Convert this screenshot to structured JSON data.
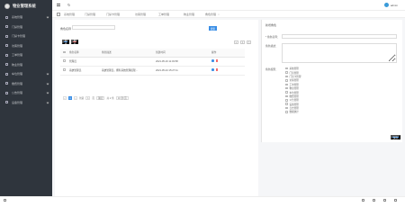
{
  "app": {
    "logo_text": "物业管理系统"
  },
  "header": {
    "user_name": "admin",
    "refresh_symbol": "↻"
  },
  "sidebar": {
    "items": [
      {
        "label": "系统管理",
        "icon": "settings-icon"
      },
      {
        "label": "门禁管理",
        "icon": "door-icon"
      },
      {
        "label": "门禁卡管理",
        "icon": "card-icon"
      },
      {
        "label": "访客管理",
        "icon": "visitor-icon"
      },
      {
        "label": "工单管理",
        "icon": "ticket-icon"
      },
      {
        "label": "物业管理",
        "icon": "building-icon"
      },
      {
        "label": "车位管理",
        "icon": "parking-icon"
      },
      {
        "label": "缴费管理",
        "icon": "payment-icon"
      },
      {
        "label": "公告管理",
        "icon": "notice-icon"
      },
      {
        "label": "设备管理",
        "icon": "device-icon"
      }
    ]
  },
  "tabs": [
    {
      "label": "系统管理"
    },
    {
      "label": "门禁管理"
    },
    {
      "label": "门禁卡管理"
    },
    {
      "label": "访客管理"
    },
    {
      "label": "工单管理"
    },
    {
      "label": "物业管理"
    },
    {
      "label": "角色管理"
    }
  ],
  "search": {
    "label": "角色名称",
    "placeholder": "",
    "button": "搜索"
  },
  "toolbar": {
    "add": "新增",
    "delete": "删除"
  },
  "table": {
    "columns": [
      "角色名称",
      "角色描述",
      "创建时间",
      "操作"
    ],
    "rows": [
      {
        "name": "管理员",
        "desc": "",
        "created": "2021-05-16 11:03:58"
      },
      {
        "name": "系统管理员",
        "desc": "系统管理员，拥有系统管理权限…",
        "created": "2021-05-24 15:27:11"
      }
    ]
  },
  "pager": {
    "prev": "‹",
    "page": "1",
    "next": "›",
    "goto_label": "到第",
    "page_input": "1",
    "page_suffix": "页",
    "confirm": "确定",
    "total": "共 2 条",
    "size": "10 条/页"
  },
  "form": {
    "title": "新增角色",
    "name_label": "* 角色名称：",
    "desc_label": "角色描述：",
    "perm_label": "角色权限：",
    "permissions": [
      "系统管理",
      "门禁管理",
      "门禁卡管理",
      "访客管理",
      "工单管理",
      "物业管理",
      "车位管理",
      "缴费管理",
      "公告管理",
      "设备管理",
      "日志管理",
      "数据统计"
    ],
    "save": "保存"
  }
}
